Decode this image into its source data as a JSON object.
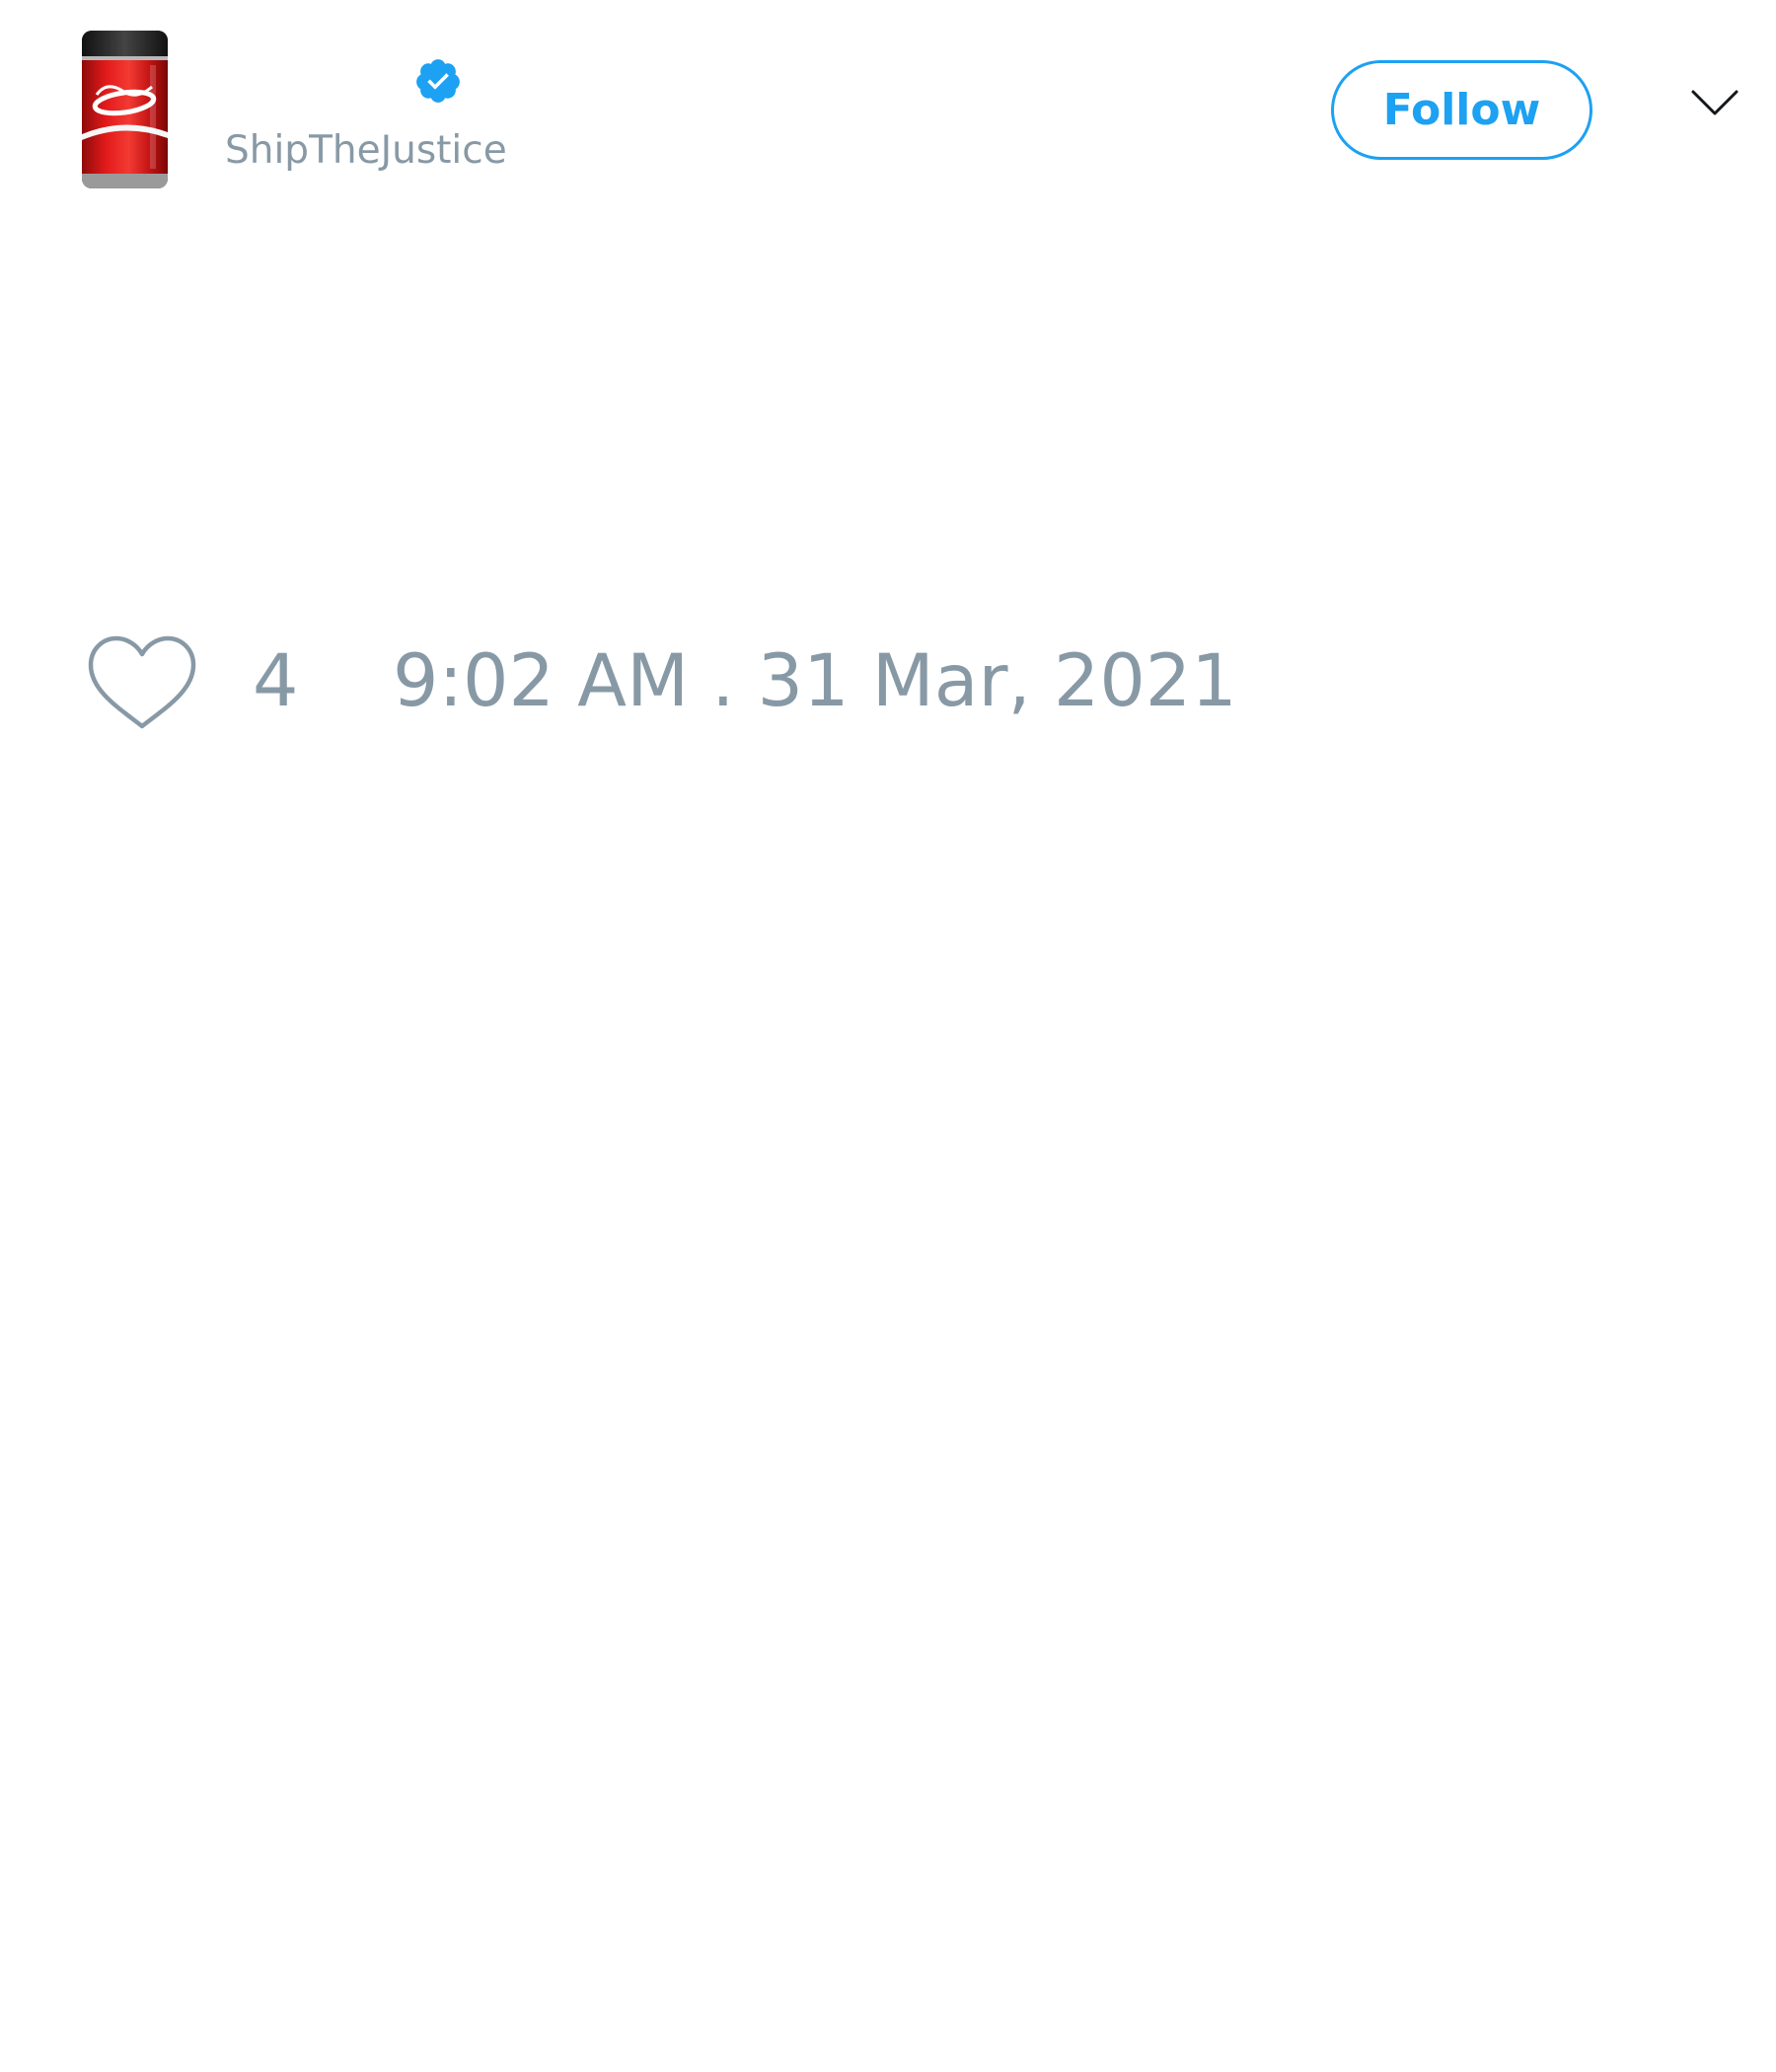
{
  "header": {
    "avatar_icon": "coca-cola-can-avatar",
    "verified_icon": "verified-badge-icon",
    "handle": "ShipTheJustice",
    "follow_label": "Follow",
    "menu_icon": "chevron-down-icon"
  },
  "footer": {
    "like_icon": "heart-outline-icon",
    "like_count": "4",
    "timestamp": "9:02 AM . 31 Mar, 2021"
  },
  "colors": {
    "accent": "#1da1f2",
    "muted_text": "#8899a6",
    "heart_stroke": "#8899a6",
    "caret": "#14171a",
    "background": "#ffffff"
  }
}
